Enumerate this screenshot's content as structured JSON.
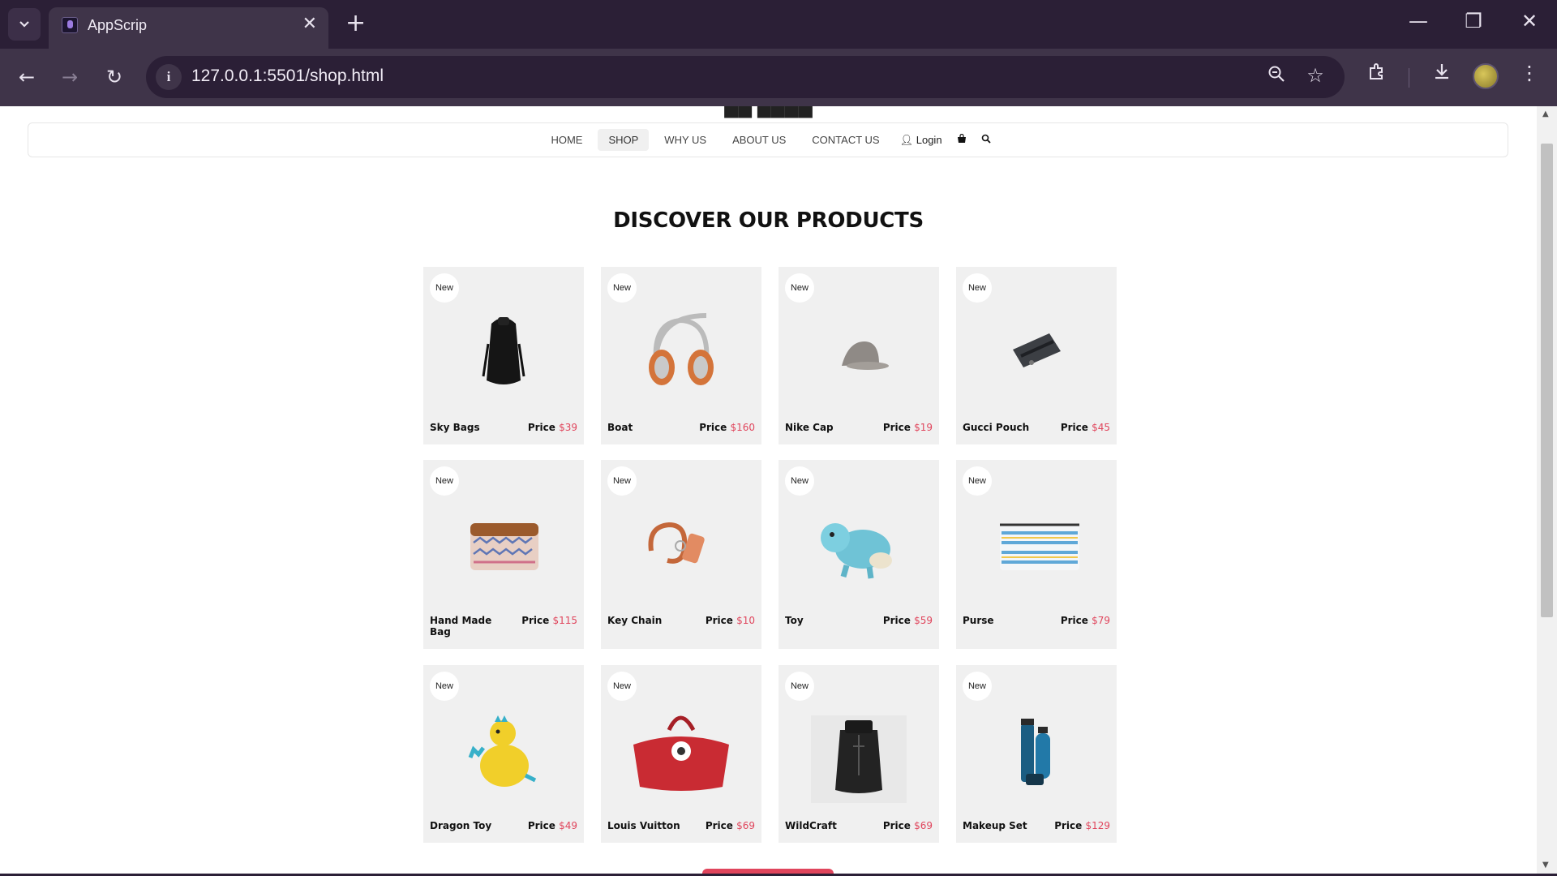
{
  "browser": {
    "tab_title": "AppScrip",
    "url": "127.0.0.1:5501/shop.html",
    "new_tab_glyph": "+",
    "icons": [
      "tab-search-icon",
      "close-icon",
      "back-icon",
      "forward-icon",
      "reload-icon",
      "info-icon",
      "zoom-icon",
      "bookmark-star-icon",
      "extensions-icon",
      "download-icon",
      "menu-icon"
    ]
  },
  "page": {
    "nav": {
      "links": [
        "HOME",
        "SHOP",
        "WHY US",
        "ABOUT US",
        "CONTACT US"
      ],
      "active": "SHOP",
      "login_label": "Login"
    },
    "heading": "DISCOVER OUR PRODUCTS",
    "badge_label": "New",
    "price_label": "Price",
    "products": [
      {
        "name": "Sky Bags",
        "price": "$39",
        "image": "black-backpack"
      },
      {
        "name": "Boat",
        "price": "$160",
        "image": "orange-headphones"
      },
      {
        "name": "Nike Cap",
        "price": "$19",
        "image": "grey-cap"
      },
      {
        "name": "Gucci Pouch",
        "price": "$45",
        "image": "dark-pouch"
      },
      {
        "name": "Hand Made Bag",
        "price": "$115",
        "image": "patterned-pouch"
      },
      {
        "name": "Key Chain",
        "price": "$10",
        "image": "leather-keychain"
      },
      {
        "name": "Toy",
        "price": "$59",
        "image": "blue-knit-toy"
      },
      {
        "name": "Purse",
        "price": "$79",
        "image": "striped-purse"
      },
      {
        "name": "Dragon Toy",
        "price": "$49",
        "image": "yellow-dragon-toy"
      },
      {
        "name": "Louis Vuitton",
        "price": "$69",
        "image": "red-handbag"
      },
      {
        "name": "WildCraft",
        "price": "$69",
        "image": "black-rolltop-backpack"
      },
      {
        "name": "Makeup Set",
        "price": "$129",
        "image": "blue-cosmetic-bottles"
      }
    ],
    "colors": {
      "accent": "#e0455c",
      "card_bg": "#f0f0f0",
      "chrome_dark": "#2b1f36",
      "chrome": "#3f3449"
    }
  }
}
